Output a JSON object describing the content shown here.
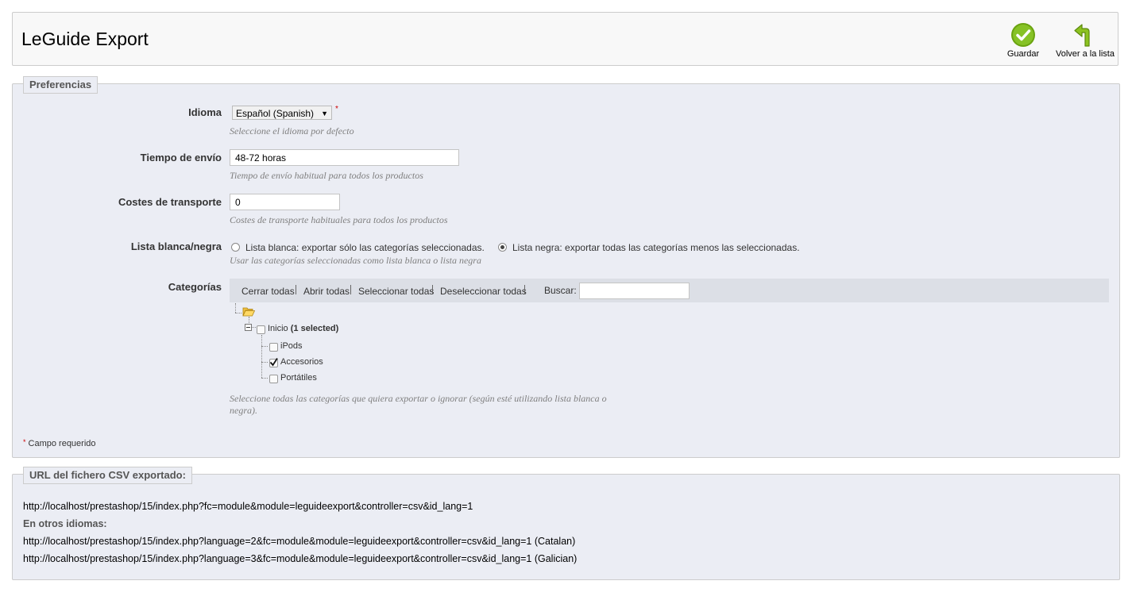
{
  "toolbar": {
    "title": "LeGuide Export",
    "save_label": "Guardar",
    "back_label": "Volver a la lista"
  },
  "prefs": {
    "legend": "Preferencias",
    "language": {
      "label": "Idioma",
      "value": "Español (Spanish)",
      "required_mark": "*",
      "hint": "Seleccione el idioma por defecto"
    },
    "shipping_time": {
      "label": "Tiempo de envío",
      "value": "48-72 horas",
      "hint": "Tiempo de envío habitual para todos los productos"
    },
    "shipping_cost": {
      "label": "Costes de transporte",
      "value": "0",
      "hint": "Costes de transporte habituales para todos los productos"
    },
    "list_mode": {
      "label": "Lista blanca/negra",
      "white_label": "Lista blanca: exportar sólo las categorías seleccionadas.",
      "black_label": "Lista negra: exportar todas las categorías menos las seleccionadas.",
      "selected": "black",
      "hint": "Usar las categorías seleccionadas como lista blanca o lista negra"
    },
    "categories": {
      "label": "Categorías",
      "toolbar": {
        "collapse_all": "Cerrar todas",
        "expand_all": "Abrir todas",
        "check_all": "Seleccionar todas",
        "uncheck_all": "Deseleccionar todas",
        "search_label": "Buscar:"
      },
      "root_label": "Inicio",
      "root_count": "(1 selected)",
      "items": [
        {
          "label": "iPods",
          "checked": false
        },
        {
          "label": "Accesorios",
          "checked": true
        },
        {
          "label": "Portátiles",
          "checked": false
        }
      ],
      "hint_line1": "Seleccione todas las categorías que quiera exportar o ignorar (según esté utilizando lista blanca o",
      "hint_line2": "negra)."
    },
    "required_note": "Campo requerido",
    "required_star": "*"
  },
  "csv": {
    "legend": "URL del fichero CSV exportado:",
    "main_url": "http://localhost/prestashop/15/index.php?fc=module&module=leguideexport&controller=csv&id_lang=1",
    "other_languages_label": "En otros idiomas:",
    "other_urls": [
      "http://localhost/prestashop/15/index.php?language=2&fc=module&module=leguideexport&controller=csv&id_lang=1 (Catalan)",
      "http://localhost/prestashop/15/index.php?language=3&fc=module&module=leguideexport&controller=csv&id_lang=1 (Galician)"
    ]
  },
  "colors": {
    "save_icon": "#7ab317",
    "back_icon": "#8cc220",
    "panel_bg": "#ebedf4",
    "required": "#cc0000"
  },
  "icons": {
    "save": "check-circle-icon",
    "back": "return-arrow-icon",
    "tree_root": "open-folder-icon",
    "tree_toggle": "collapse-minus-icon"
  }
}
